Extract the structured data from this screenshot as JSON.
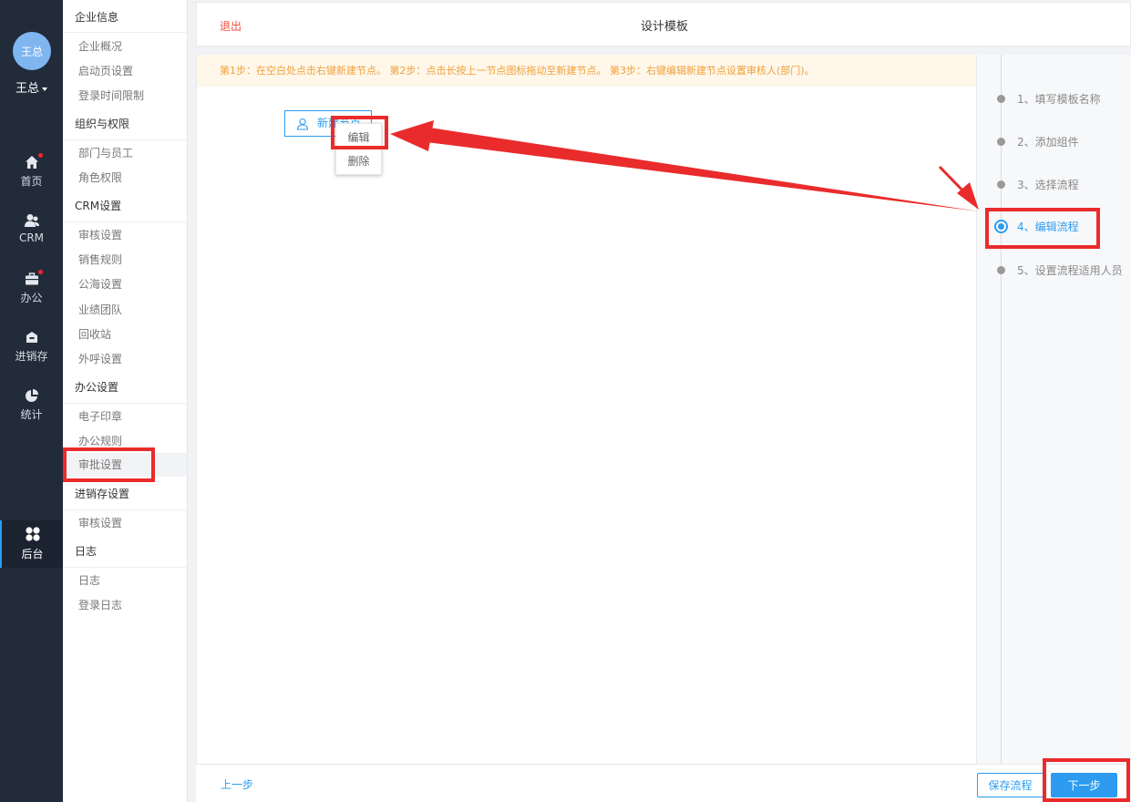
{
  "user": {
    "avatar_text": "王总",
    "name": "王总"
  },
  "nav": [
    {
      "label": "首页",
      "icon": "home-icon",
      "badge": true
    },
    {
      "label": "CRM",
      "icon": "users-icon",
      "badge": false
    },
    {
      "label": "办公",
      "icon": "briefcase-icon",
      "badge": true
    },
    {
      "label": "进销存",
      "icon": "warehouse-icon",
      "badge": false
    },
    {
      "label": "统计",
      "icon": "pie-chart-icon",
      "badge": false
    },
    {
      "label": "后台",
      "icon": "grid-icon",
      "badge": false,
      "active": true
    }
  ],
  "submenu": {
    "groups": [
      {
        "title": "企业信息",
        "items": [
          "企业概况",
          "启动页设置",
          "登录时间限制"
        ]
      },
      {
        "title": "组织与权限",
        "items": [
          "部门与员工",
          "角色权限"
        ]
      },
      {
        "title": "CRM设置",
        "items": [
          "审核设置",
          "销售规则",
          "公海设置",
          "业绩团队",
          "回收站",
          "外呼设置"
        ]
      },
      {
        "title": "办公设置",
        "items": [
          "电子印章",
          "办公规则",
          "审批设置"
        ]
      },
      {
        "title": "进销存设置",
        "items": [
          "审核设置"
        ]
      },
      {
        "title": "日志",
        "items": [
          "日志",
          "登录日志"
        ]
      }
    ],
    "active_item": "审批设置"
  },
  "header": {
    "exit_label": "退出",
    "title": "设计模板"
  },
  "tip": "第1步：在空白处点击右键新建节点。 第2步：点击长按上一节点图标拖动至新建节点。 第3步：右键编辑新建节点设置审核人(部门)。",
  "node": {
    "label": "新建节点"
  },
  "context_menu": {
    "edit": "编辑",
    "delete": "删除"
  },
  "steps": [
    {
      "label": "1、填写模板名称",
      "active": false
    },
    {
      "label": "2、添加组件",
      "active": false
    },
    {
      "label": "3、选择流程",
      "active": false
    },
    {
      "label": "4、编辑流程",
      "active": true
    },
    {
      "label": "5、设置流程适用人员",
      "active": false
    }
  ],
  "footer": {
    "prev_label": "上一步",
    "save_label": "保存流程",
    "next_label": "下一步"
  },
  "colors": {
    "primary": "#2d9cf0",
    "annotation": "#ea2b2b",
    "tip_text": "#f1a13c",
    "tip_bg": "#fef7ea",
    "nav_bg": "#222b3a",
    "exit": "#f04b3b"
  }
}
